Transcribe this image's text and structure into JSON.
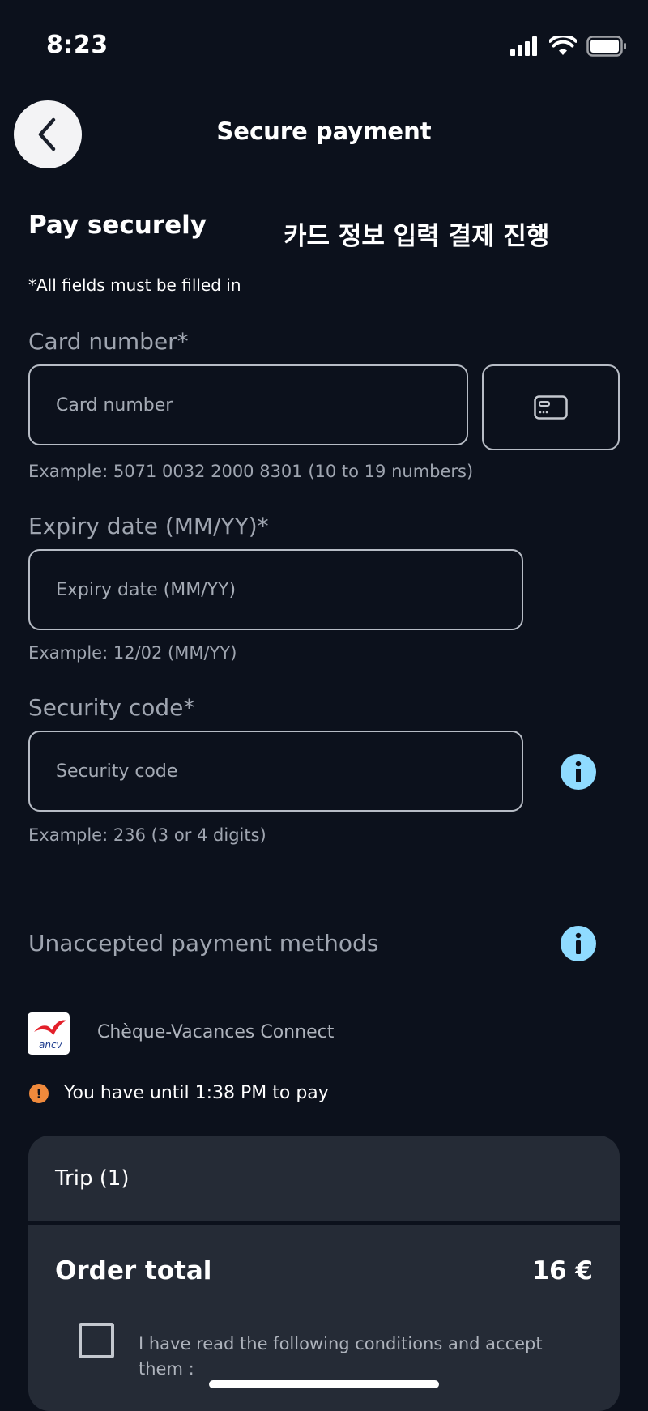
{
  "status_bar": {
    "time": "8:23"
  },
  "header": {
    "title": "Secure payment",
    "back_icon": "chevron-left-icon"
  },
  "form": {
    "section_title": "Pay securely",
    "annotation": "카드 정보 입력 결제 진행",
    "required_note": "*All fields must be filled in",
    "card_number": {
      "label": "Card number*",
      "placeholder": "Card number",
      "value": "",
      "hint": "Example: 5071 0032 2000 8301 (10 to 19 numbers)",
      "scan_icon": "credit-card-icon"
    },
    "expiry": {
      "label": "Expiry date (MM/YY)*",
      "placeholder": "Expiry date (MM/YY)",
      "value": "",
      "hint": "Example: 12/02 (MM/YY)"
    },
    "security_code": {
      "label": "Security code*",
      "placeholder": "Security code",
      "value": "",
      "hint": "Example: 236 (3 or 4 digits)",
      "info_icon": "info-icon"
    }
  },
  "unaccepted": {
    "label": "Unaccepted payment methods",
    "info_icon": "info-icon",
    "methods": [
      {
        "name": "Chèque-Vacances Connect",
        "logo_text": "ancv"
      }
    ]
  },
  "deadline": {
    "icon": "warning-icon",
    "text": "You have until 1:38 PM to pay"
  },
  "summary": {
    "trip_label": "Trip (1)",
    "order_total_label": "Order total",
    "order_total_value": "16 €",
    "conditions_text": "I have read the following conditions and accept them :",
    "conditions_checked": false
  },
  "colors": {
    "background": "#0c111c",
    "card": "#252b36",
    "info_accent": "#8fdbff",
    "warning": "#f08a3c",
    "brand_red": "#e3202a",
    "brand_blue": "#1b3a8c"
  }
}
